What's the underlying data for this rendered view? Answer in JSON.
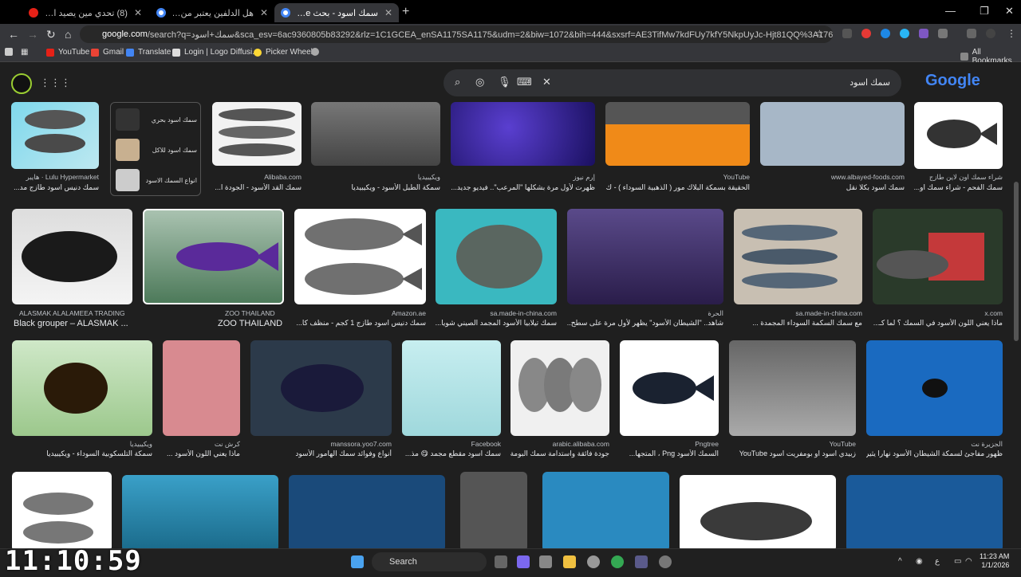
{
  "tabs": [
    {
      "label": "(8) تحدي مين يصيد اكبر سمكة!🐟",
      "active": false
    },
    {
      "label": "هل الدلفين يعتبر من الاسماك - بـ",
      "active": false
    },
    {
      "label": "سمك اسود - بحث Google",
      "active": true
    }
  ],
  "address": {
    "host": "google.com",
    "path": "/search?q=سمك+اسود&sca_esv=6ac9360805b83292&rlz=1C1GCEA_enSA1175SA1175&udm=2&biw=1072&bih=444&sxsrf=AE3TifMw7kdFUy7kfY5NkpUyJc-Hjt81QQ%3A1767254292256&ei=FClWaa2..."
  },
  "bookmarks": [
    "YouTube",
    "Gmail",
    "Translate",
    "Login | Logo Diffusi...",
    "Picker Wheel",
    "All Bookmarks"
  ],
  "search": {
    "query": "سمك اسود"
  },
  "logo": "Google",
  "related": [
    {
      "label": "سمك اسود بحري"
    },
    {
      "label": "سمك اسود للاكل"
    },
    {
      "label": "انواع السمك الاسود"
    }
  ],
  "results": [
    {
      "source": "Lulu Hypermarket · هايبر",
      "title": "سمك دنيس اسود طازج مد..."
    },
    {
      "source": "Alibaba.com",
      "title": "سمك القد الأسود - الجودة ا..."
    },
    {
      "source": "ويكيبيديا",
      "title": "سمكة الطبل الأسود - ويكيبيديا"
    },
    {
      "source": "إرم نيوز",
      "title": "ظهرت لأول مرة بشكلها \"المرعب\".. فيديو جديد..."
    },
    {
      "source": "YouTube",
      "title": "الحقيقة بسمكة البلاك مور ( الذهبية السوداء ) - ك..."
    },
    {
      "source": "www.albayed-foods.com",
      "title": "سمك اسود بكلا نقل"
    },
    {
      "source": "شراء سمك اون لاين طازج",
      "title": "سمك الفحم - شراء سمك او..."
    },
    {
      "source": "ALASMAK ALALAMEEA TRADING",
      "title": "Black grouper – ALASMAK ..."
    },
    {
      "source": "ZOO THAILAND",
      "title": "ZOO THAILAND"
    },
    {
      "source": "Amazon.ae",
      "title": "سمك دنيس اسود طازج 1 كجم - منظف كا..."
    },
    {
      "source": "sa.made-in-china.com",
      "title": "سمك تيلابيا الأسود المجمد الصيني شويا..."
    },
    {
      "source": "الحرة",
      "title": "شاهد.. \"الشيطان الأسود\" يظهر لأول مرة على سطح..."
    },
    {
      "source": "sa.made-in-china.com",
      "title": "مع سمك السكمة السوداء المجمدة ..."
    },
    {
      "source": "x.com",
      "title": "ماذا يعني اللون الأسود في السمك ؟ لما كـ..."
    },
    {
      "source": "ويكيبيديا",
      "title": "سمكة التلسكوبية السوداء - ويكيبيديا"
    },
    {
      "source": "كرش نت",
      "title": "ماذا يعني اللون الأسود ..."
    },
    {
      "source": "manssora.yoo7.com",
      "title": "أنواع وفوائد سمك الهامور الأسود"
    },
    {
      "source": "Facebook",
      "title": "سمك اسود مقطع مجمد 😋 مذ..."
    },
    {
      "source": "arabic.alibaba.com",
      "title": "جودة فائقة واستدامة سمك البومة..."
    },
    {
      "source": "Pngtree",
      "title": "السمك الأسود Png ، المتجها..."
    },
    {
      "source": "YouTube",
      "title": "زبيدي اسود او بومفريت اسود YouTube"
    },
    {
      "source": "الجزيرة نت",
      "title": "ظهور مفاجئ لسمكة الشيطان الأسود نهارا يثير..."
    }
  ],
  "overlay": {
    "clock": "11:10:59"
  },
  "taskbar": {
    "search_label": "Search",
    "time": "11:23 AM",
    "date": "1/1/2026",
    "lang": "ع"
  }
}
